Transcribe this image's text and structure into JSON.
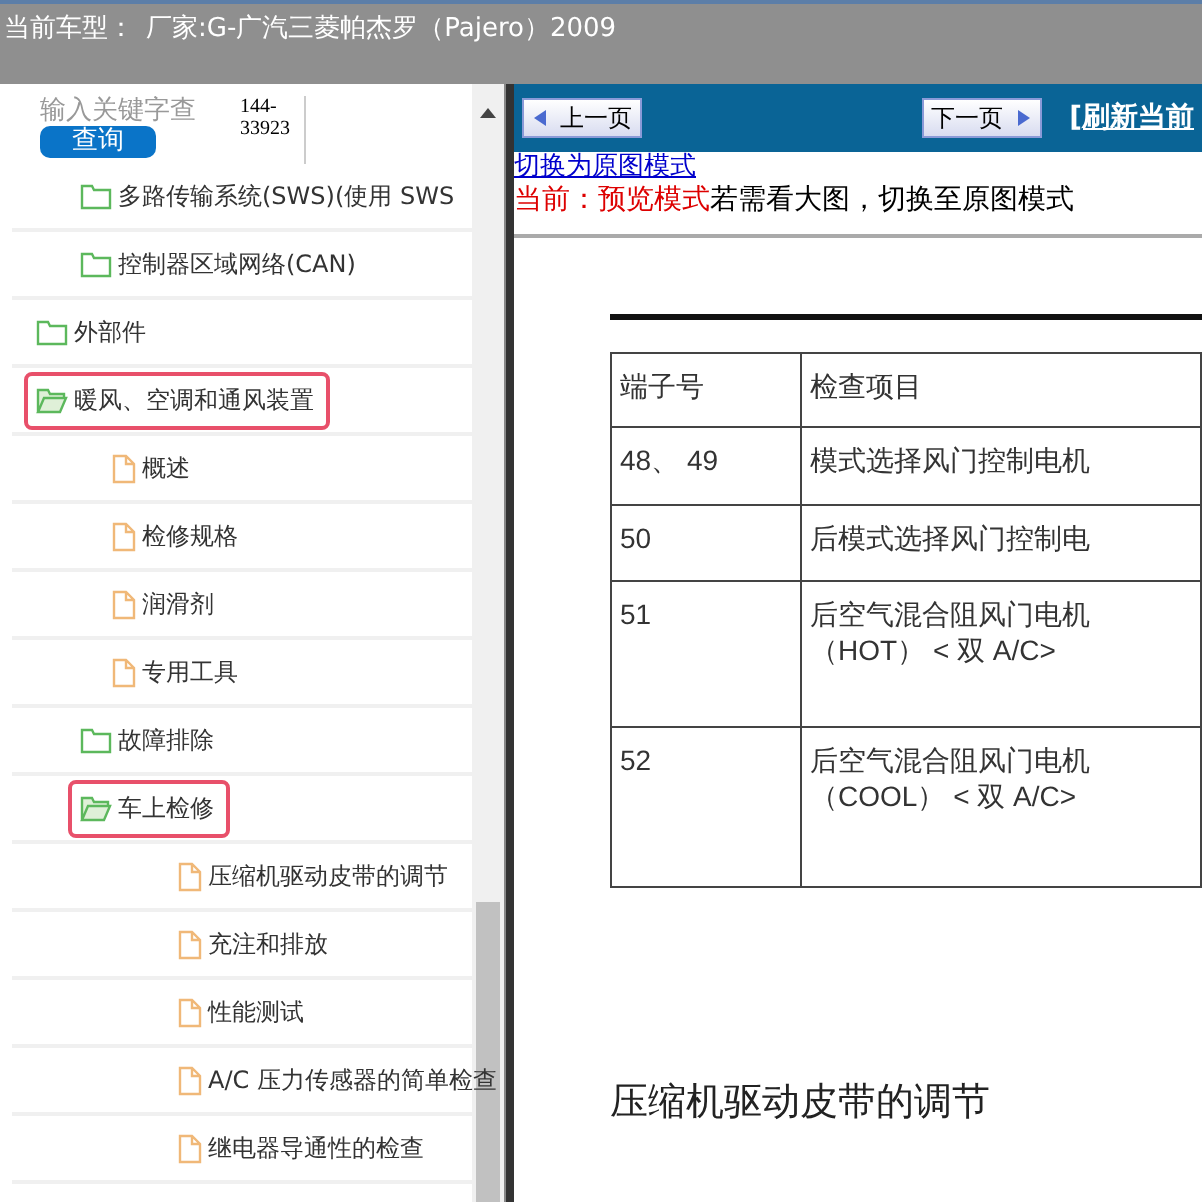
{
  "title_bar": {
    "label": "当前车型：",
    "value": "厂家:G-广汽三菱帕杰罗（Pajero）2009"
  },
  "search": {
    "placeholder": "输入关键字查",
    "code": "144-33923",
    "button": "查询"
  },
  "tree": {
    "nested_above": [
      {
        "label": "多路传输系统(SWS)(使用 SWS",
        "kind": "folder",
        "expanded": false,
        "selected": false
      },
      {
        "label": "控制器区域网络(CAN)",
        "kind": "folder",
        "expanded": false,
        "selected": false
      }
    ],
    "items": [
      {
        "label": "外部件",
        "kind": "folder",
        "expanded": false,
        "selected": false
      },
      {
        "label": "暖风、空调和通风装置",
        "kind": "folder",
        "expanded": true,
        "selected": true,
        "children": [
          {
            "label": "概述",
            "kind": "doc",
            "selected": false
          },
          {
            "label": "检修规格",
            "kind": "doc",
            "selected": false
          },
          {
            "label": "润滑剂",
            "kind": "doc",
            "selected": false
          },
          {
            "label": "专用工具",
            "kind": "doc",
            "selected": false
          },
          {
            "label": "故障排除",
            "kind": "folder",
            "expanded": false,
            "selected": false
          },
          {
            "label": "车上检修",
            "kind": "folder",
            "expanded": true,
            "selected": true,
            "children": [
              {
                "label": "压缩机驱动皮带的调节",
                "kind": "doc",
                "selected": false
              },
              {
                "label": "充注和排放",
                "kind": "doc",
                "selected": false
              },
              {
                "label": "性能测试",
                "kind": "doc",
                "selected": false
              },
              {
                "label": "A/C 压力传感器的简单检查",
                "kind": "doc",
                "selected": false
              },
              {
                "label": "继电器导通性的检查",
                "kind": "doc",
                "selected": false
              }
            ]
          }
        ]
      }
    ]
  },
  "toolbar": {
    "prev": "上一页",
    "next": "下一页",
    "refresh": "[刷新当前"
  },
  "mode_link": "切换为原图模式",
  "mode_notice": {
    "current": "当前：预览模式",
    "hint": "若需看大图，切换至原图模式"
  },
  "document": {
    "table": {
      "columns": [
        "端子号",
        "检查项目"
      ],
      "rows": [
        [
          "48、 49",
          "模式选择风门控制电机"
        ],
        [
          "50",
          "后模式选择风门控制电"
        ],
        [
          "51",
          "后空气混合阻风门电机（HOT） < 双 A/C>"
        ],
        [
          "52",
          "后空气混合阻风门电机（COOL） < 双 A/C>"
        ]
      ]
    },
    "heading": "压缩机驱动皮带的调节"
  }
}
